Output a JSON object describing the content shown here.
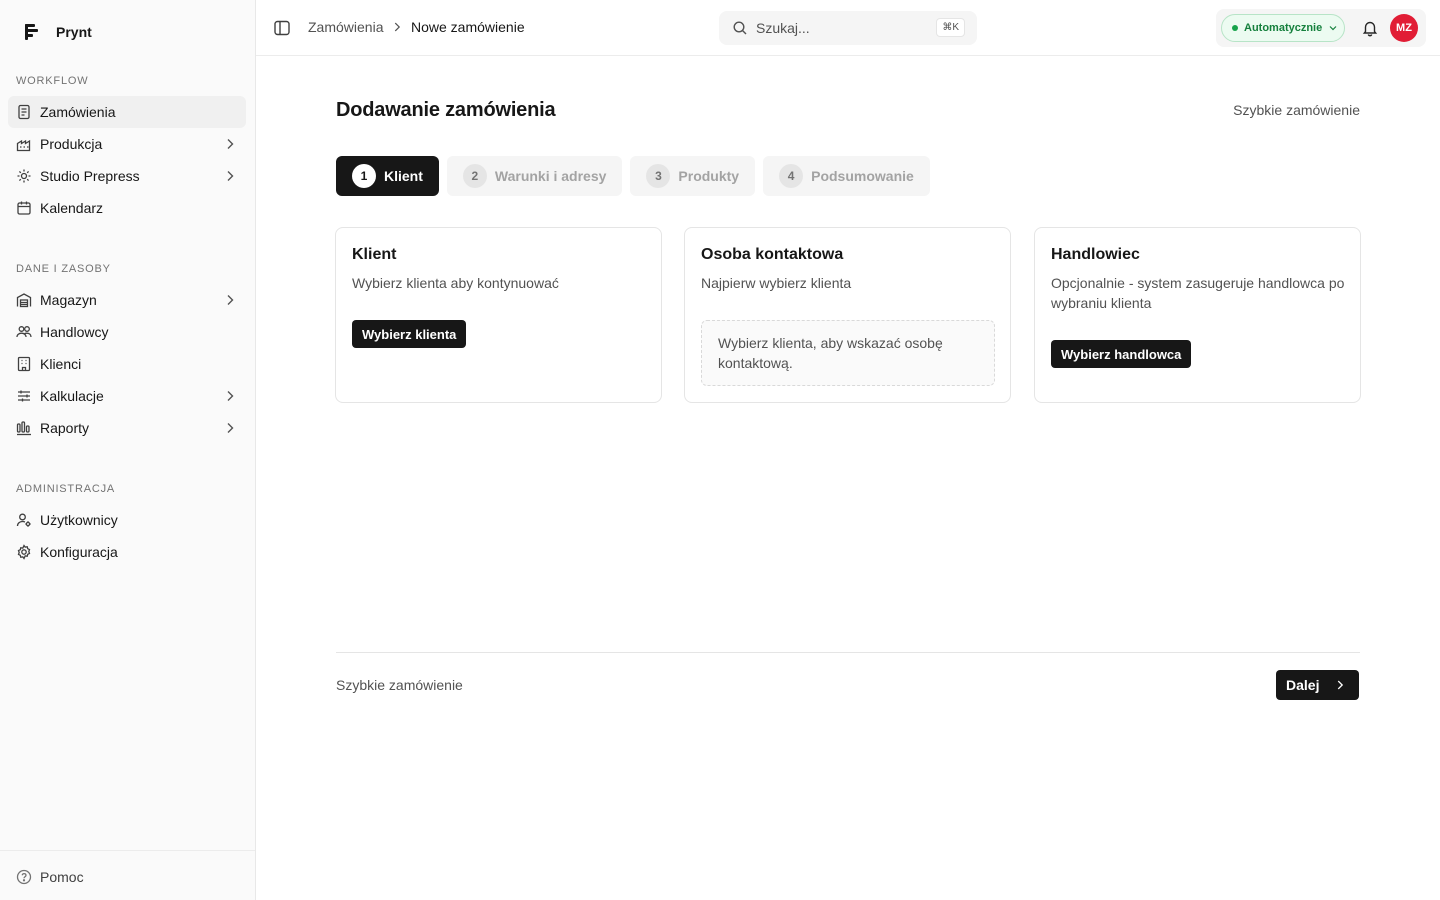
{
  "app": {
    "name": "Prynt"
  },
  "sidebar": {
    "sections": [
      {
        "label": "WORKFLOW",
        "items": [
          {
            "label": "Zamówienia",
            "icon": "orders-icon",
            "active": true,
            "has_children": false
          },
          {
            "label": "Produkcja",
            "icon": "factory-icon",
            "active": false,
            "has_children": true
          },
          {
            "label": "Studio Prepress",
            "icon": "studio-icon",
            "active": false,
            "has_children": true
          },
          {
            "label": "Kalendarz",
            "icon": "calendar-icon",
            "active": false,
            "has_children": false
          }
        ]
      },
      {
        "label": "DANE I ZASOBY",
        "items": [
          {
            "label": "Magazyn",
            "icon": "warehouse-icon",
            "active": false,
            "has_children": true
          },
          {
            "label": "Handlowcy",
            "icon": "users-icon",
            "active": false,
            "has_children": false
          },
          {
            "label": "Klienci",
            "icon": "building-icon",
            "active": false,
            "has_children": false
          },
          {
            "label": "Kalkulacje",
            "icon": "sliders-icon",
            "active": false,
            "has_children": true
          },
          {
            "label": "Raporty",
            "icon": "chart-icon",
            "active": false,
            "has_children": true
          }
        ]
      },
      {
        "label": "ADMINISTRACJA",
        "items": [
          {
            "label": "Użytkownicy",
            "icon": "user-cog-icon",
            "active": false,
            "has_children": false
          },
          {
            "label": "Konfiguracja",
            "icon": "gear-icon",
            "active": false,
            "has_children": false
          }
        ]
      }
    ],
    "footer": {
      "help_label": "Pomoc"
    }
  },
  "header": {
    "breadcrumb": [
      "Zamówienia",
      "Nowe zamówienie"
    ],
    "search": {
      "placeholder": "Szukaj...",
      "shortcut": "⌘K"
    },
    "mode": {
      "label": "Automatycznie",
      "color": "#16a34a"
    },
    "user": {
      "initials": "MZ",
      "avatar_color": "#e11d35"
    }
  },
  "main": {
    "title": "Dodawanie zamówienia",
    "quick_order_link": "Szybkie zamówienie",
    "steps": [
      {
        "number": "1",
        "label": "Klient",
        "active": true
      },
      {
        "number": "2",
        "label": "Warunki i adresy",
        "active": false
      },
      {
        "number": "3",
        "label": "Produkty",
        "active": false
      },
      {
        "number": "4",
        "label": "Podsumowanie",
        "active": false
      }
    ],
    "cards": {
      "client": {
        "title": "Klient",
        "description": "Wybierz klienta aby kontynuować",
        "button": "Wybierz klienta"
      },
      "contact": {
        "title": "Osoba kontaktowa",
        "description": "Najpierw wybierz klienta",
        "placeholder": "Wybierz klienta, aby wskazać osobę kontaktową."
      },
      "sales": {
        "title": "Handlowiec",
        "description": "Opcjonalnie - system zasugeruje handlowca po wybraniu klienta",
        "button": "Wybierz handlowca"
      }
    },
    "footer": {
      "quick_order_link": "Szybkie zamówienie",
      "next_button": "Dalej"
    }
  }
}
